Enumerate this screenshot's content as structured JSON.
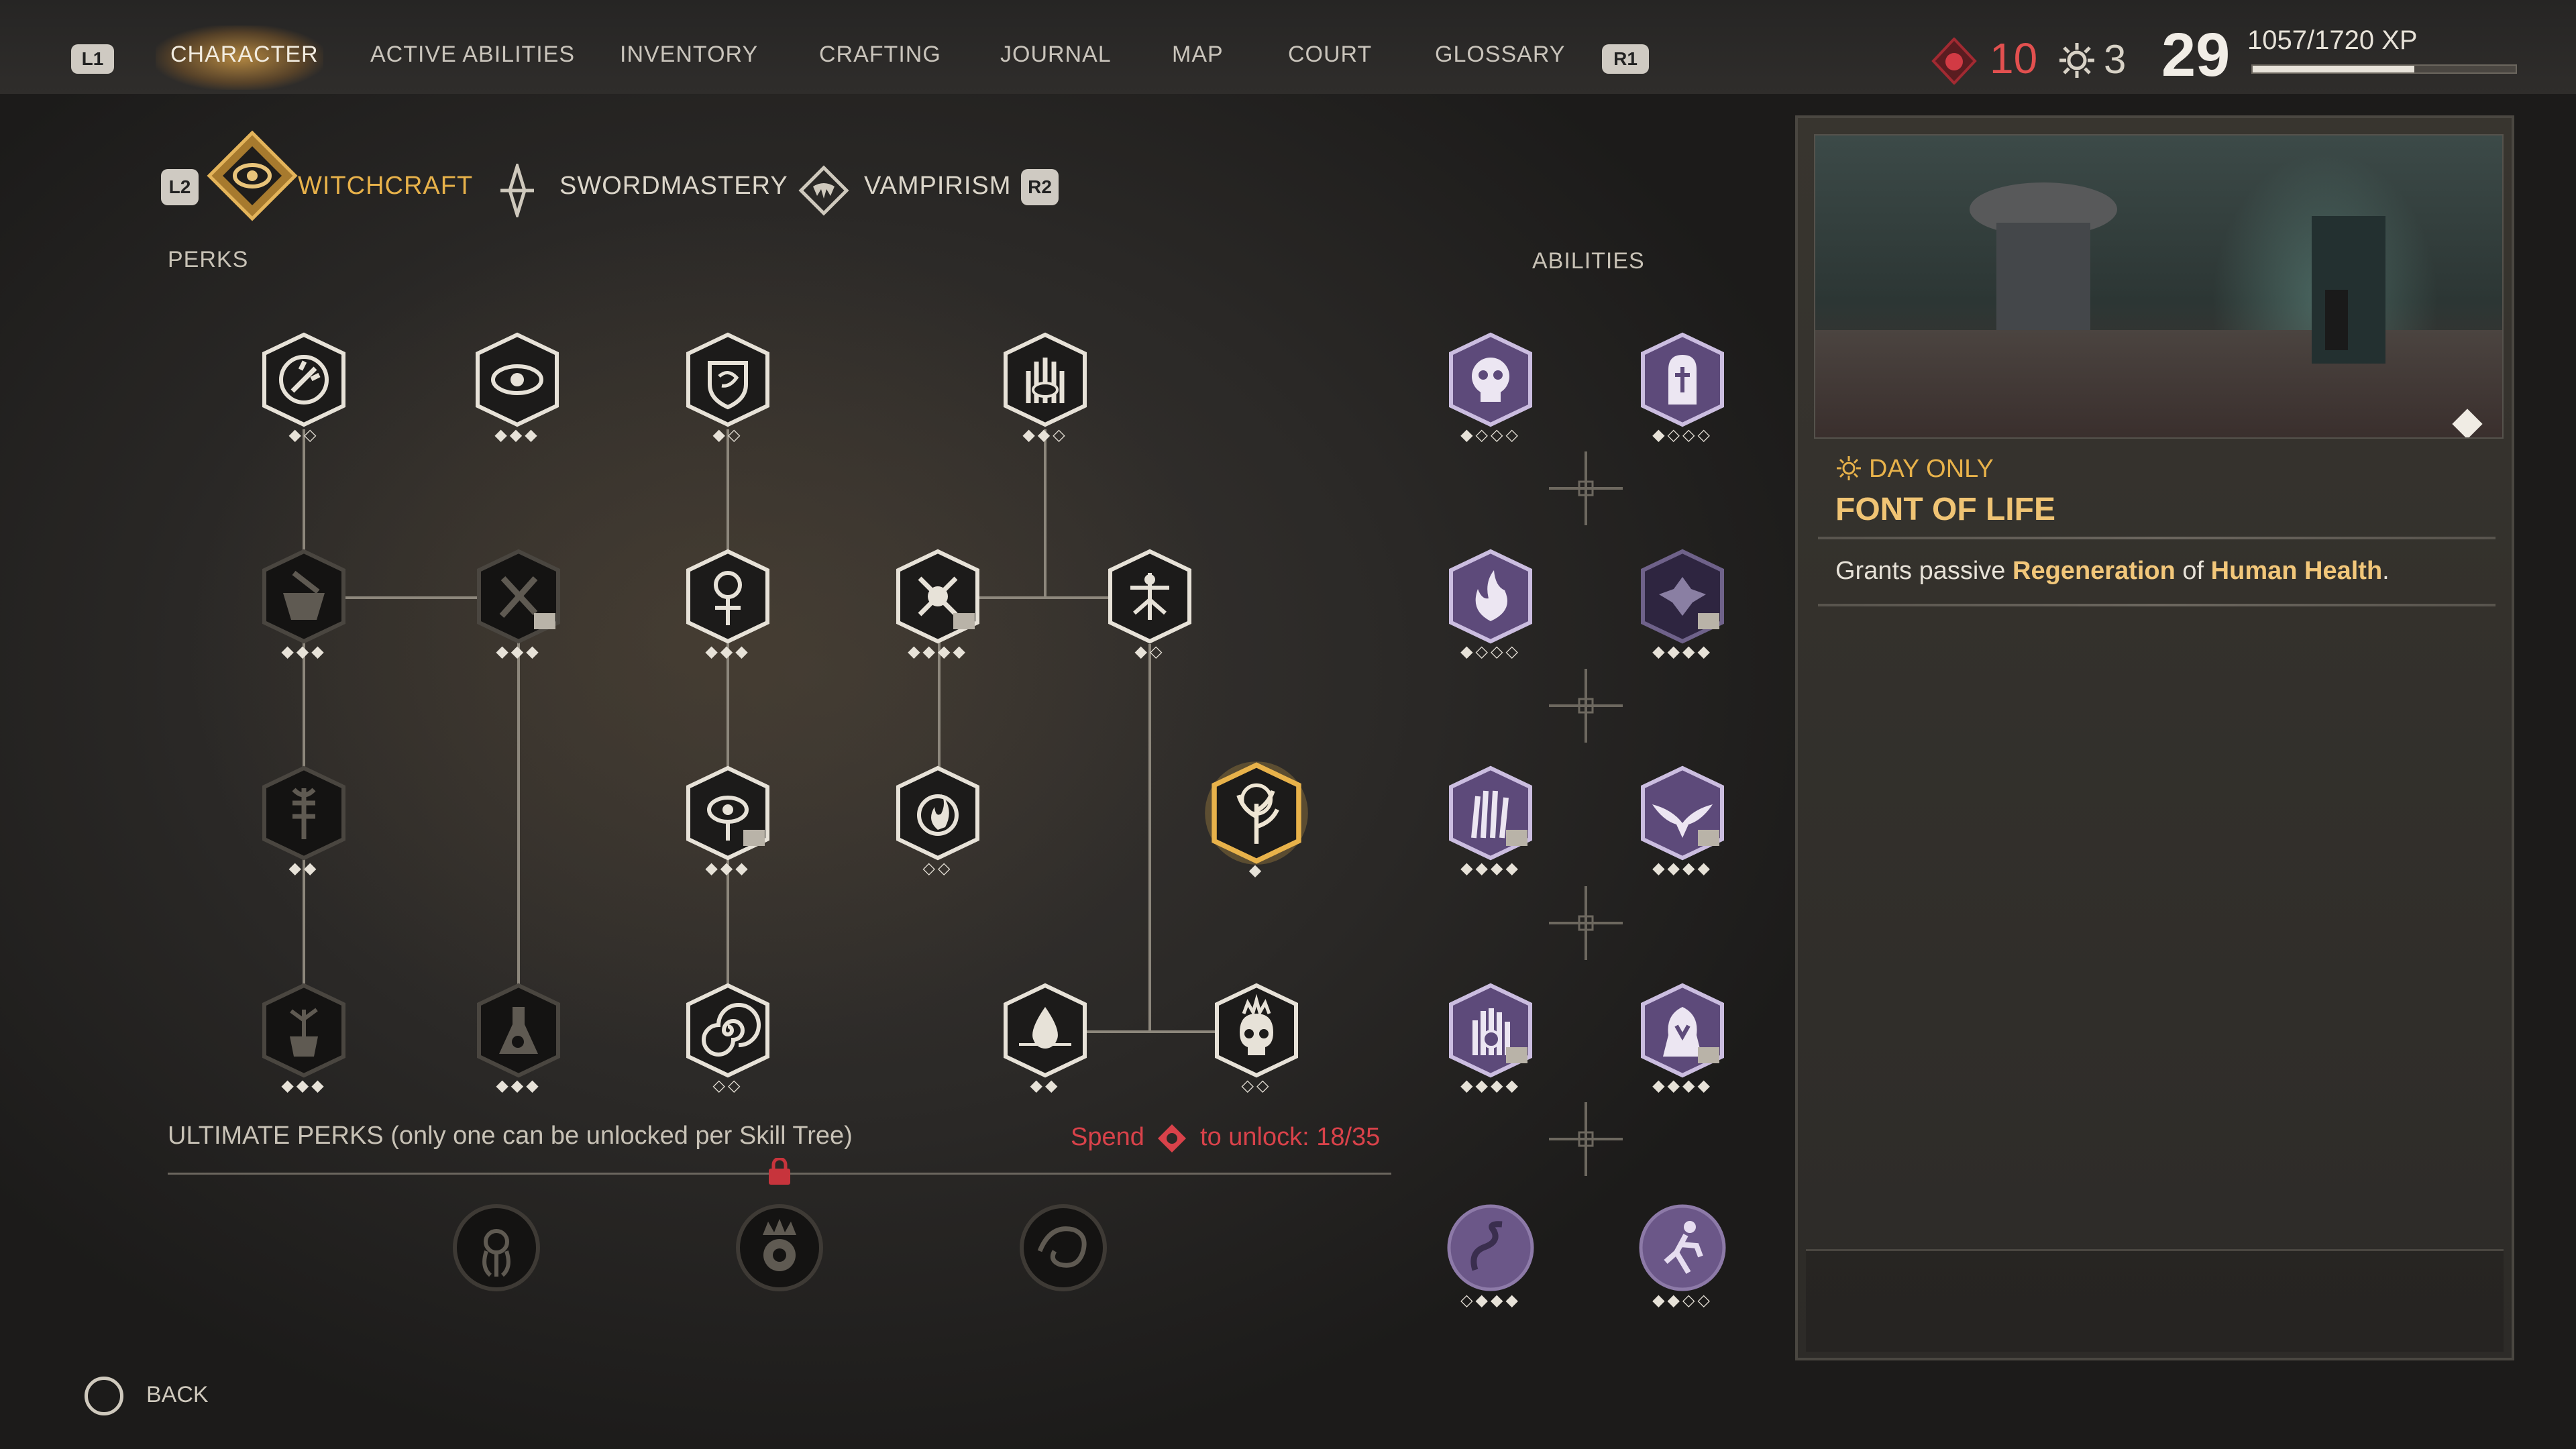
{
  "nav": {
    "left_button": "L1",
    "right_button": "R1",
    "items": [
      "CHARACTER",
      "ACTIVE ABILITIES",
      "INVENTORY",
      "CRAFTING",
      "JOURNAL",
      "MAP",
      "COURT",
      "GLOSSARY"
    ],
    "active_index": 0
  },
  "stats": {
    "blood_points": "10",
    "skill_points": "3",
    "level": "29",
    "xp_text": "1057/1720 XP",
    "xp_progress": 0.614
  },
  "tabs": {
    "left_button": "L2",
    "right_button": "R2",
    "items": [
      "WITCHCRAFT",
      "SWORDMASTERY",
      "VAMPIRISM"
    ],
    "active_index": 0
  },
  "sections": {
    "perks": "PERKS",
    "abilities": "ABILITIES",
    "ultimate": "ULTIMATE PERKS (only one can be unlocked per Skill Tree)",
    "spend_prefix": "Spend",
    "spend_suffix": "to unlock: 18/35"
  },
  "perk_nodes": [
    {
      "icon": "dagger-spark-icon",
      "dots": "◆◇",
      "owned": true
    },
    {
      "icon": "eye-icon",
      "dots": "◆◆◆",
      "owned": true
    },
    {
      "icon": "serpent-shield-icon",
      "dots": "◆◇",
      "owned": true
    },
    {
      "icon": "hand-eye-icon",
      "dots": "◆◆◇",
      "owned": true
    },
    {
      "icon": "mortar-icon",
      "dots": "◆◆◆",
      "owned": false
    },
    {
      "icon": "tools-book-icon",
      "dots": "◆◆◆",
      "owned": false
    },
    {
      "icon": "ankh-skull-icon",
      "dots": "◆◆◆",
      "owned": true
    },
    {
      "icon": "cross-skull-book-icon",
      "dots": "◆◆◆◆",
      "owned": true
    },
    {
      "icon": "radiant-figure-icon",
      "dots": "◆◇",
      "owned": true
    },
    {
      "icon": "rune-icon",
      "dots": "◆◆",
      "owned": false
    },
    {
      "icon": "eye-glyph-book-icon",
      "dots": "◆◆◆",
      "owned": true
    },
    {
      "icon": "flame-circle-icon",
      "dots": "◇◇",
      "owned": true
    },
    {
      "icon": "tree-of-life-icon",
      "dots": "◆",
      "owned": true
    },
    {
      "icon": "pot-plant-icon",
      "dots": "◆◆◆",
      "owned": false
    },
    {
      "icon": "flask-skull-icon",
      "dots": "◆◆◆",
      "owned": false
    },
    {
      "icon": "spiral-icon",
      "dots": "◇◇",
      "owned": true
    },
    {
      "icon": "drop-icon",
      "dots": "◆◆",
      "owned": true
    },
    {
      "icon": "flaming-skull-icon",
      "dots": "◇◇",
      "owned": true
    }
  ],
  "ability_dots": [
    "◆◇◇◇",
    "◆◇◇◇",
    "◆◇◇◇",
    "◆◆◆◆",
    "◆◆◆◆",
    "◆◆◆◆",
    "◆◆◆◆",
    "◆◆◆◆",
    "◇◆◆◆",
    "◆◆◇◇"
  ],
  "abilities": [
    "grinning-skull-icon",
    "tombstone-icon",
    "flame-swirl-icon",
    "bat-burst-book-icon",
    "clawed-hand-book-icon",
    "winged-raven-book-icon",
    "palm-eye-book-icon",
    "hooded-figure-book-icon",
    "serpent-icon",
    "running-figure-icon"
  ],
  "ultimate_icons": [
    "tentacle-eye-icon",
    "crowned-skull-icon",
    "swirling-beast-icon"
  ],
  "detail": {
    "tag": "DAY ONLY",
    "title": "FONT OF LIFE",
    "desc_prefix": "Grants passive",
    "desc_hl1": "Regeneration",
    "desc_mid": "of",
    "desc_hl2": "Human Health",
    "desc_suffix": "."
  },
  "footer": {
    "back_label": "BACK"
  },
  "colors": {
    "accent": "#e8b24a",
    "spend": "#d9424a",
    "ability_purple": "#5d4a7a"
  }
}
